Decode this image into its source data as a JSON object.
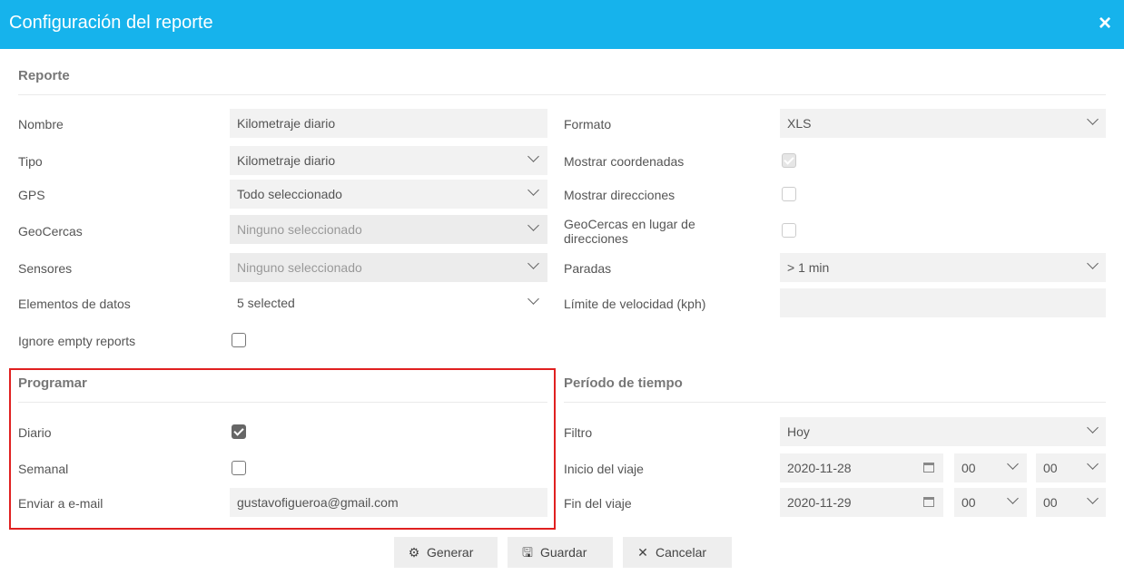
{
  "window": {
    "title": "Configuración del reporte",
    "close_icon": "×"
  },
  "sections": {
    "reporte": "Reporte",
    "programar": "Programar",
    "periodo": "Período de tiempo"
  },
  "left": {
    "nombre": {
      "label": "Nombre",
      "value": "Kilometraje diario"
    },
    "tipo": {
      "label": "Tipo",
      "value": "Kilometraje diario"
    },
    "gps": {
      "label": "GPS",
      "value": "Todo seleccionado"
    },
    "geocercas": {
      "label": "GeoCercas",
      "value": "Ninguno seleccionado"
    },
    "sensores": {
      "label": "Sensores",
      "value": "Ninguno seleccionado"
    },
    "elementos": {
      "label": "Elementos de datos",
      "value": "5 selected"
    },
    "ignore": {
      "label": "Ignore empty reports",
      "checked": false
    }
  },
  "right": {
    "formato": {
      "label": "Formato",
      "value": "XLS"
    },
    "mostrar_coordenadas": {
      "label": "Mostrar coordenadas",
      "checked": true,
      "disabled": true
    },
    "mostrar_direcciones": {
      "label": "Mostrar direcciones",
      "checked": false
    },
    "geocercas_lugar": {
      "label": "GeoCercas en lugar de direcciones",
      "checked": false
    },
    "paradas": {
      "label": "Paradas",
      "value": "> 1 min"
    },
    "limite": {
      "label": "Límite de velocidad (kph)",
      "value": ""
    }
  },
  "programar": {
    "diario": {
      "label": "Diario",
      "checked": true
    },
    "semanal": {
      "label": "Semanal",
      "checked": false
    },
    "email": {
      "label": "Enviar a e-mail",
      "value": "gustavofigueroa@gmail.com"
    }
  },
  "periodo": {
    "filtro": {
      "label": "Filtro",
      "value": "Hoy"
    },
    "inicio": {
      "label": "Inicio del viaje",
      "date": "2020-11-28",
      "hour": "00",
      "minute": "00"
    },
    "fin": {
      "label": "Fin del viaje",
      "date": "2020-11-29",
      "hour": "00",
      "minute": "00"
    }
  },
  "buttons": {
    "generar": {
      "label": "Generar",
      "icon": "gear-icon"
    },
    "guardar": {
      "label": "Guardar",
      "icon": "floppy-icon"
    },
    "cancelar": {
      "label": "Cancelar",
      "icon": "x-icon"
    }
  },
  "colors": {
    "header": "#16b3ec",
    "highlight_border": "#e02020"
  }
}
